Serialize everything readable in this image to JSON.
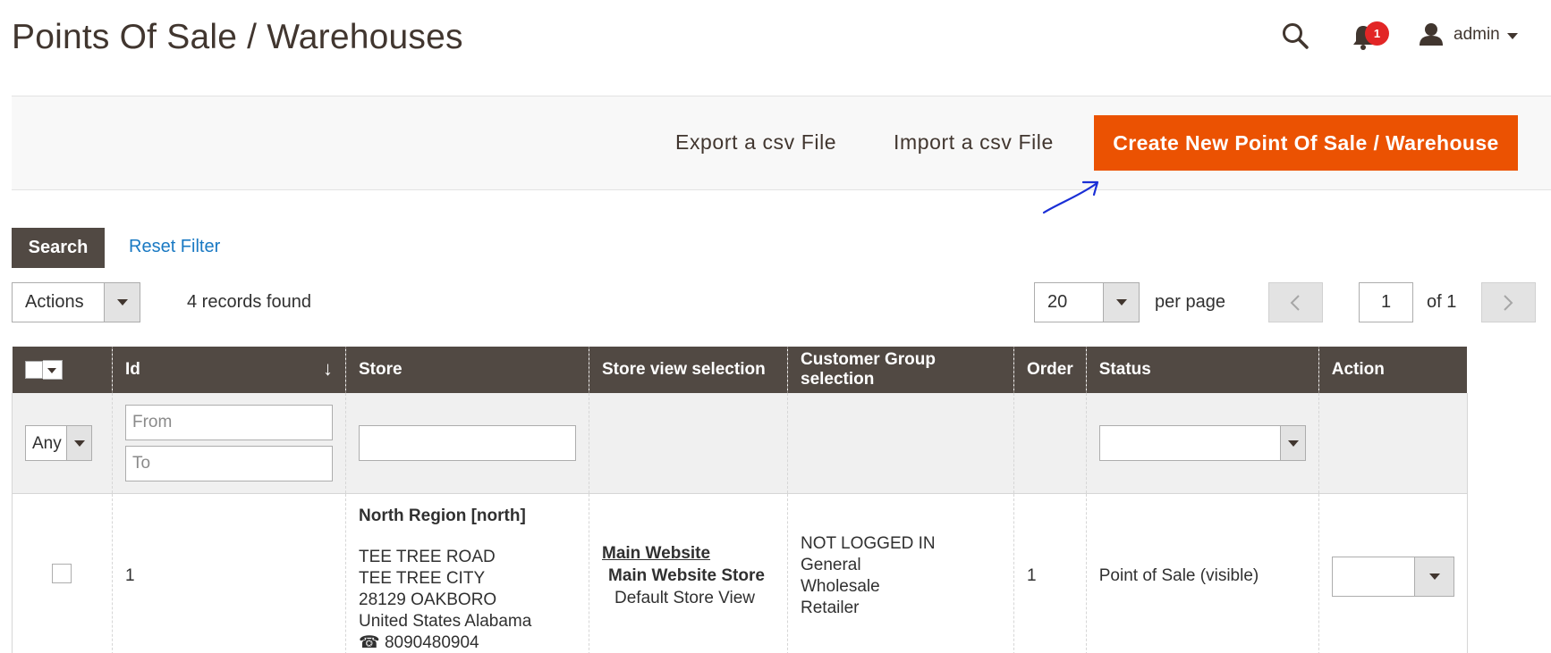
{
  "header": {
    "title": "Points Of Sale / Warehouses",
    "notification_count": "1",
    "user_name": "admin"
  },
  "toolbar": {
    "export_label": "Export a csv File",
    "import_label": "Import a csv File",
    "create_label": "Create New Point Of Sale / Warehouse",
    "accent_color": "#eb5202"
  },
  "filters": {
    "search_label": "Search",
    "reset_label": "Reset Filter"
  },
  "grid_controls": {
    "actions_value": "Actions",
    "records_found": "4 records found",
    "per_page_value": "20",
    "per_page_label": "per page",
    "current_page": "1",
    "page_total": "of 1"
  },
  "table": {
    "columns": [
      "Id",
      "Store",
      "Store view selection",
      "Customer Group selection",
      "Order",
      "Status",
      "Action"
    ],
    "filter": {
      "mass_select_value": "Any",
      "id_from_placeholder": "From",
      "id_to_placeholder": "To"
    },
    "rows": [
      {
        "id": "1",
        "store_name": "North Region [north]",
        "address": [
          "TEE TREE ROAD",
          "TEE TREE CITY",
          "28129 OAKBORO",
          "United States Alabama"
        ],
        "phone": "8090480904",
        "website": "Main Website",
        "store": "Main Website Store",
        "store_view": "Default Store View",
        "customer_groups": [
          "NOT LOGGED IN",
          "General",
          "Wholesale",
          "Retailer"
        ],
        "order": "1",
        "status": "Point of Sale (visible)"
      }
    ]
  }
}
